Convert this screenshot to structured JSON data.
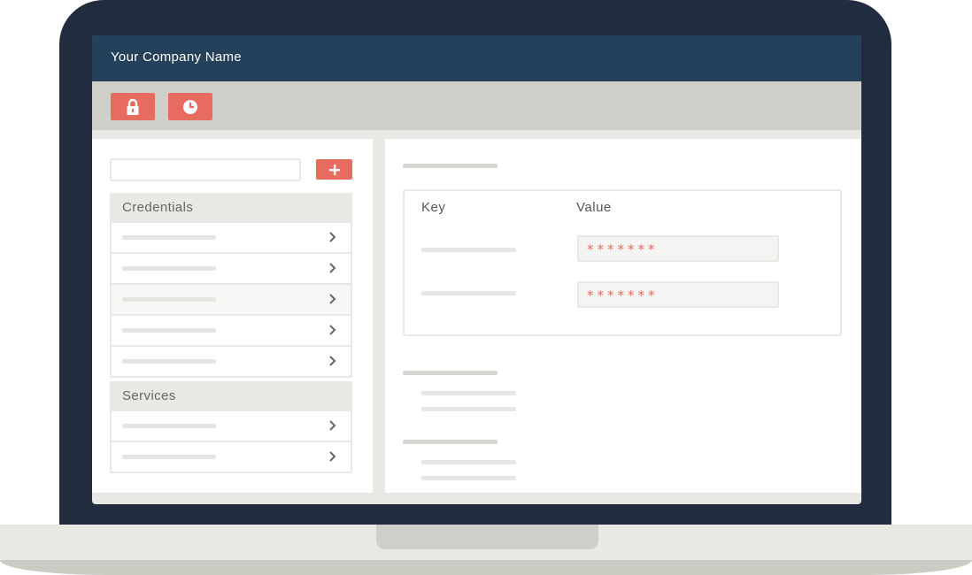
{
  "header": {
    "company_name": "Your Company Name"
  },
  "toolbar": {
    "buttons": [
      {
        "icon": "lock-icon"
      },
      {
        "icon": "clock-icon"
      }
    ]
  },
  "sidebar": {
    "groups": [
      {
        "title": "Credentials",
        "row_count": 5
      },
      {
        "title": "Services",
        "row_count": 2
      }
    ]
  },
  "detail": {
    "table_headers": {
      "key": "Key",
      "value": "Value"
    },
    "rows": [
      {
        "value": "*******"
      },
      {
        "value": "*******"
      }
    ]
  },
  "colors": {
    "accent": "#e76b5f",
    "header_bg": "#24405a",
    "bezel": "#212c3f"
  }
}
